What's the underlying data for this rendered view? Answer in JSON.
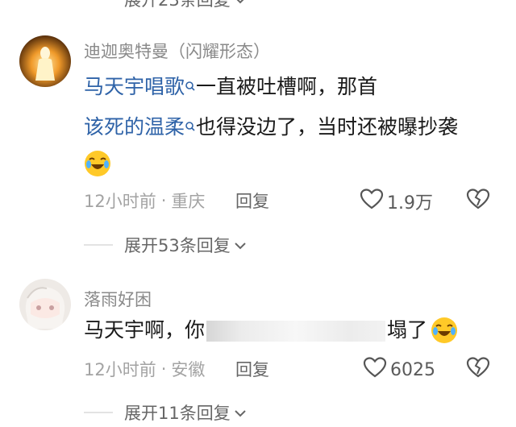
{
  "top_expand": {
    "label": "展开23条回复"
  },
  "comments": [
    {
      "username": "迪迦奥特曼（闪耀形态）",
      "link1": "马天宇唱歌",
      "text1": "一直被吐槽啊，那首",
      "link2": "该死的温柔",
      "text2": "也得没边了，当时还被曝抄袭",
      "time": "12小时前",
      "location": "重庆",
      "reply_label": "回复",
      "likes": "1.9万",
      "expand_label": "展开53条回复"
    },
    {
      "username": "落雨好困",
      "text_start": "马天宇啊，你",
      "text_end": "塌了",
      "time": "12小时前",
      "location": "安徽",
      "reply_label": "回复",
      "likes": "6025",
      "expand_label": "展开11条回复"
    }
  ],
  "separator": "·",
  "icons": [
    "chevron-down-icon",
    "search-icon",
    "heart-icon",
    "broken-heart-icon",
    "laugh-cry-emoji-icon"
  ],
  "colors": {
    "link": "#2f63a8",
    "meta": "#a3a3a3",
    "background": "#ffffff"
  }
}
